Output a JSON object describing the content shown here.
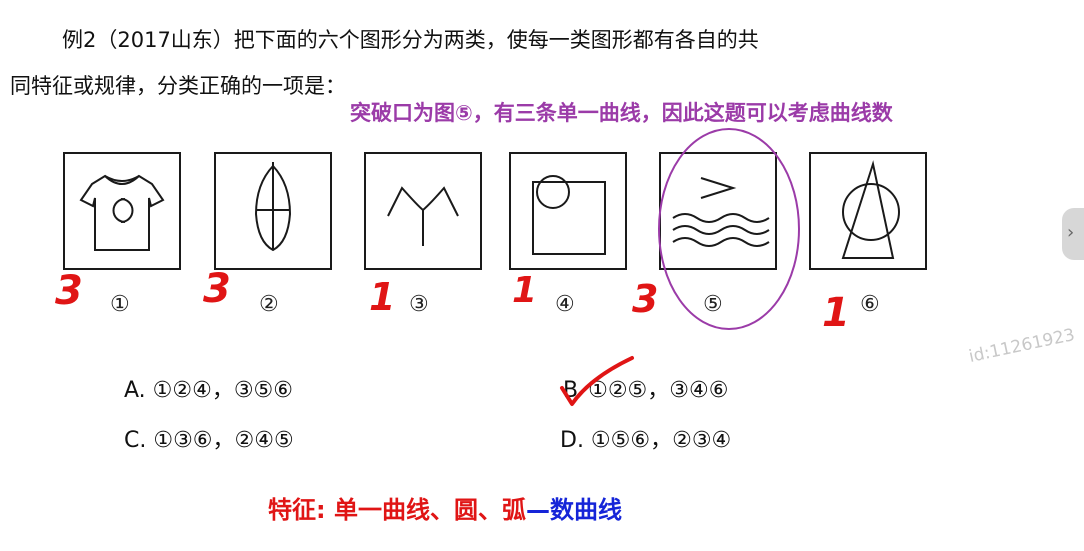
{
  "question": {
    "line1": "例2（2017山东）把下面的六个图形分为两类，使每一类图形都有各自的共",
    "line2": "同特征或规律，分类正确的一项是："
  },
  "hint": "突破口为图⑤，有三条单一曲线，因此这题可以考虑曲线数",
  "figures": [
    {
      "label": "①",
      "content": "t-shirt"
    },
    {
      "label": "②",
      "content": "leaf"
    },
    {
      "label": "③",
      "content": "branch"
    },
    {
      "label": "④",
      "content": "circle-square"
    },
    {
      "label": "⑤",
      "content": "waves"
    },
    {
      "label": "⑥",
      "content": "triangle-circle"
    }
  ],
  "handwritten_counts": [
    "3",
    "3",
    "1",
    "1",
    "3",
    "1"
  ],
  "options": {
    "a": "A. ①②④，③⑤⑥",
    "b_prefix": "B",
    "b": "①②⑤，③④⑥",
    "c": "C. ①③⑥，②④⑤",
    "d": "D. ①⑤⑥，②③④"
  },
  "feature": {
    "red": "特征: 单一曲线、圆、弧",
    "blue": "—数曲线"
  },
  "watermark": "id:11261923",
  "side_tab_glyph": "›",
  "colors": {
    "hint": "#9b3ba8",
    "annotation_red": "#e01515",
    "feature_blue": "#1525d8"
  }
}
